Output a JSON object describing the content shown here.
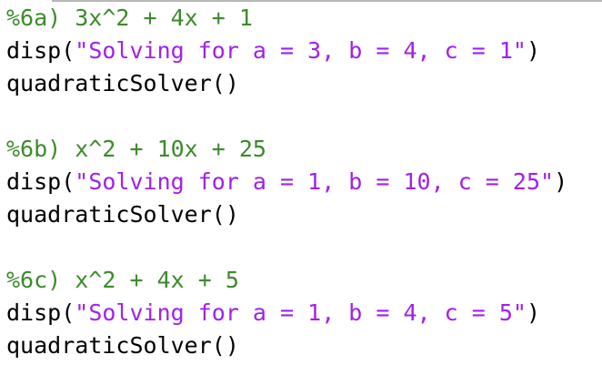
{
  "colors": {
    "comment": "#3d8a2c",
    "string": "#a020f0",
    "text": "#000000",
    "background": "#ffffff"
  },
  "code": {
    "blocks": [
      {
        "comment": "%6a) 3x^2 + 4x + 1",
        "disp_prefix": "disp(",
        "disp_string": "\"Solving for a = 3, b = 4, c = 1\"",
        "disp_suffix": ")",
        "call": "quadraticSolver()"
      },
      {
        "comment": "%6b) x^2 + 10x + 25",
        "disp_prefix": "disp(",
        "disp_string": "\"Solving for a = 1, b = 10, c = 25\"",
        "disp_suffix": ")",
        "call": "quadraticSolver()"
      },
      {
        "comment": "%6c) x^2 + 4x + 5",
        "disp_prefix": "disp(",
        "disp_string": "\"Solving for a = 1, b = 4, c = 5\"",
        "disp_suffix": ")",
        "call": "quadraticSolver()"
      }
    ]
  }
}
